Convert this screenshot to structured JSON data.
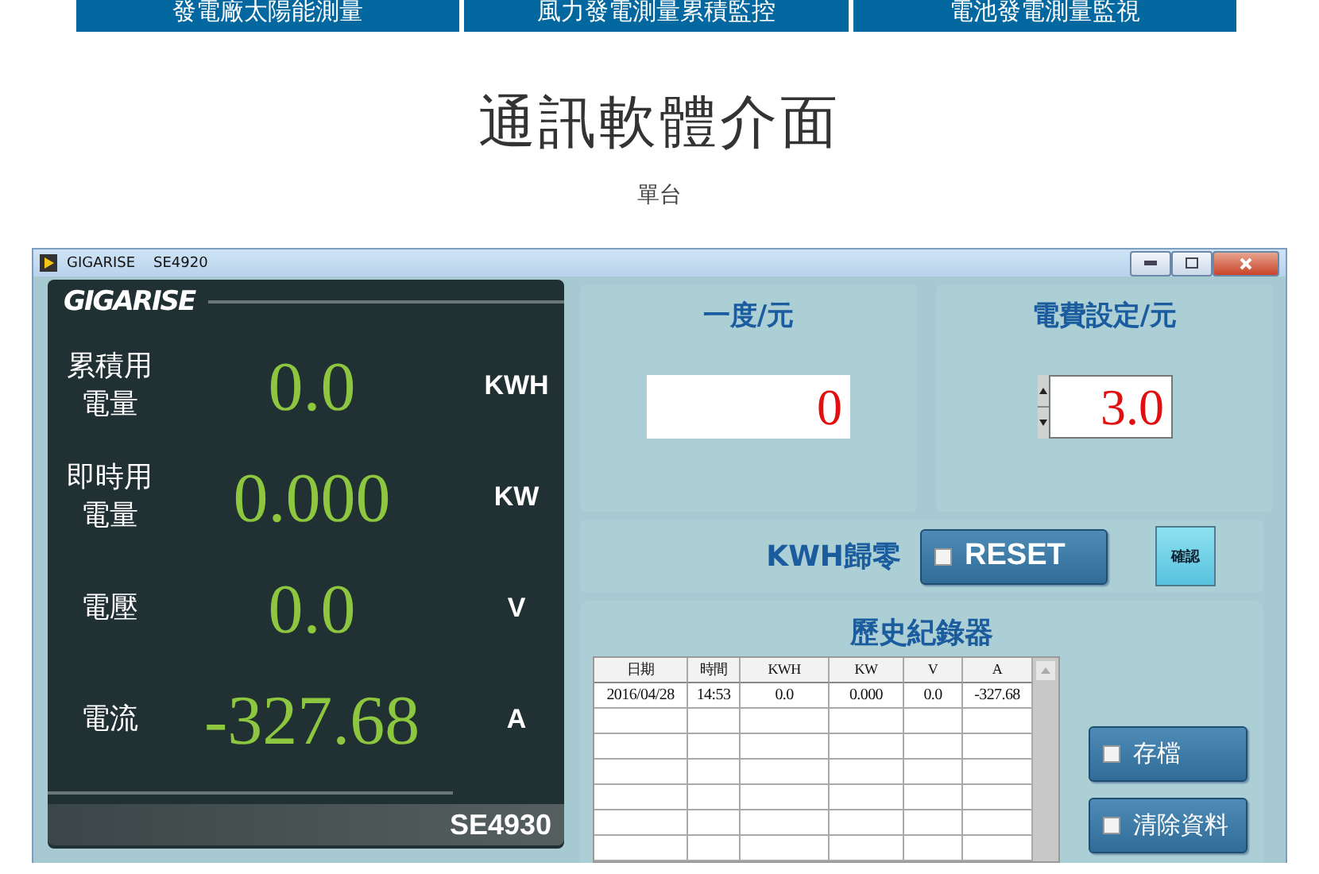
{
  "nav_tabs": [
    {
      "label": "發電廠太陽能測量"
    },
    {
      "label": "風力發電測量累積監控"
    },
    {
      "label": "電池發電測量監視"
    }
  ],
  "heading": "通訊軟體介面",
  "subheading": "單台",
  "window": {
    "title": "GIGARISE    SE4920"
  },
  "meter_panel": {
    "logo": "GIGARISE",
    "model": "SE4930",
    "readings": [
      {
        "label": "累積用電量",
        "value": "0.0",
        "unit": "KWH"
      },
      {
        "label": "即時用電量",
        "value": "0.000",
        "unit": "KW"
      },
      {
        "label": "電壓",
        "value": "0.0",
        "unit": "V"
      },
      {
        "label": "電流",
        "value": "-327.68",
        "unit": "A"
      }
    ]
  },
  "cost_card": {
    "title": "一度/元",
    "value": "0"
  },
  "rate_card": {
    "title": "電費設定/元",
    "value": "3.0"
  },
  "reset_row": {
    "label": "KWH歸零",
    "reset_button": "RESET",
    "confirm_button": "確認"
  },
  "history": {
    "title": "歷史紀錄器",
    "table": {
      "columns": [
        "日期",
        "時間",
        "KWH",
        "KW",
        "V",
        "A"
      ],
      "rows": [
        [
          "2016/04/28",
          "14:53",
          "0.0",
          "0.000",
          "0.0",
          "-327.68"
        ]
      ]
    },
    "buttons": [
      "存檔",
      "清除資料"
    ]
  }
}
